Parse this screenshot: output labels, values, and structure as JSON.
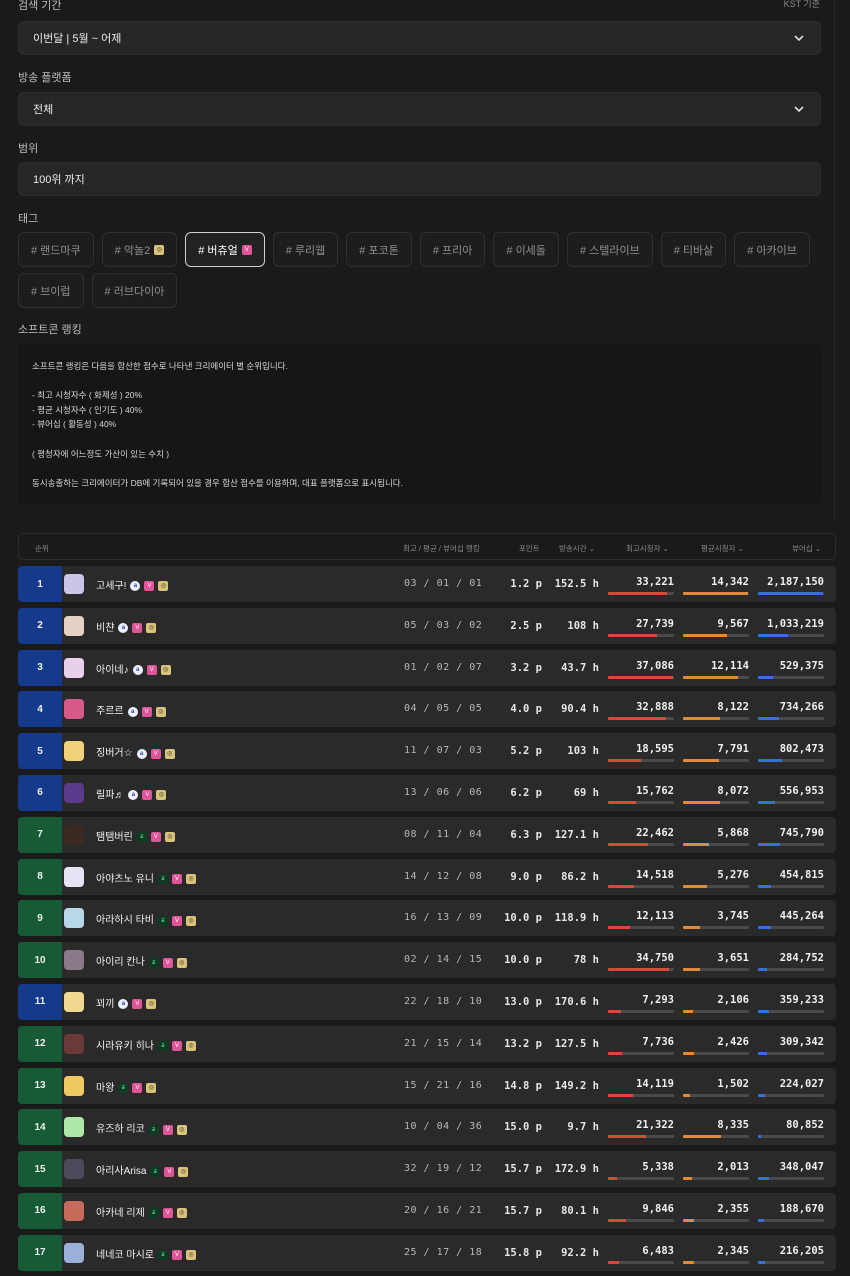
{
  "filters": {
    "period_label": "검색 기간",
    "kst_note": "KST 기준",
    "period_value": "이번달 | 5월 ~ 어제",
    "platform_label": "방송 플랫폼",
    "platform_value": "전체",
    "range_label": "범위",
    "range_value": "100위 까지",
    "tags_label": "태그",
    "tags": [
      "# 랜드마쿠",
      "# 악놀2",
      "# 버츄얼",
      "# 루리웹",
      "# 포코톤",
      "# 프리아",
      "# 이세돌",
      "# 스텔라이브",
      "# 티바살",
      "# 아카이브",
      "# 브이럽",
      "# 러브다이아"
    ]
  },
  "ranking_info": {
    "title": "소프트콘 랭킹",
    "lines": [
      "소프트콘 랭킹은 다음을 합산한 점수로 나타낸 크리에이터 별 순위입니다.",
      "",
      "- 최고 시청자수 ( 화제성 ) 20%",
      "- 평균 시청자수 ( 인기도 ) 40%",
      "- 뷰어십 ( 활동성 ) 40%",
      "",
      "( 평청자에 어느정도 가산이 있는 수치 )",
      "",
      "동시송출하는 크리에이터가 DB에 기록되어 있을 경우 합산 점수를 이용하며, 대표 플랫폼으로 표시됩니다."
    ]
  },
  "table": {
    "headers": {
      "rank": "순위",
      "sub_ranks": "최고 / 평균 / 뷰어십 랭킹",
      "points": "포인트",
      "hours": "방송시간 ⌄",
      "peak": "최고시청자 ⌄",
      "avg": "평균시청자 ⌄",
      "viewership": "뷰어십 ⌄"
    },
    "colors": {
      "blue_rank": "#153a8c",
      "green_rank": "#165a36",
      "peak_bar": "#d94a3a",
      "avg_bar": "#e08a3c",
      "viewership_bar": "#3a6fd9"
    },
    "rows": [
      {
        "rank": "1",
        "name": "고세구!",
        "platform": "blue",
        "ranks": "03 / 01 / 01",
        "points": "1.2 p",
        "hours": "152.5 h",
        "peak": "33,221",
        "avg": "14,342",
        "viewership": "2,187,150",
        "pf": 0.89,
        "af": 0.98,
        "vf": 0.98,
        "avatar": "#c9c6e8"
      },
      {
        "rank": "2",
        "name": "비챤",
        "platform": "blue",
        "ranks": "05 / 03 / 02",
        "points": "2.5 p",
        "hours": "108 h",
        "peak": "27,739",
        "avg": "9,567",
        "viewership": "1,033,219",
        "pf": 0.74,
        "af": 0.66,
        "vf": 0.46,
        "avatar": "#e6d2c4"
      },
      {
        "rank": "3",
        "name": "아이네♪",
        "platform": "blue",
        "ranks": "01 / 02 / 07",
        "points": "3.2 p",
        "hours": "43.7 h",
        "peak": "37,086",
        "avg": "12,114",
        "viewership": "529,375",
        "pf": 0.99,
        "af": 0.84,
        "vf": 0.23,
        "avatar": "#e8d0ea"
      },
      {
        "rank": "4",
        "name": "주르르",
        "platform": "blue",
        "ranks": "04 / 05 / 05",
        "points": "4.0 p",
        "hours": "90.4 h",
        "peak": "32,888",
        "avg": "8,122",
        "viewership": "734,266",
        "pf": 0.88,
        "af": 0.56,
        "vf": 0.32,
        "avatar": "#d65a8a"
      },
      {
        "rank": "5",
        "name": "징버거☆",
        "platform": "blue",
        "ranks": "11 / 07 / 03",
        "points": "5.2 p",
        "hours": "103 h",
        "peak": "18,595",
        "avg": "7,791",
        "viewership": "802,473",
        "pf": 0.5,
        "af": 0.54,
        "vf": 0.36,
        "avatar": "#f0d27a"
      },
      {
        "rank": "6",
        "name": "릴파♬",
        "platform": "blue",
        "ranks": "13 / 06 / 06",
        "points": "6.2 p",
        "hours": "69 h",
        "peak": "15,762",
        "avg": "8,072",
        "viewership": "556,953",
        "pf": 0.42,
        "af": 0.56,
        "vf": 0.25,
        "avatar": "#5a3a8a"
      },
      {
        "rank": "7",
        "name": "탬탬버린",
        "platform": "green",
        "ranks": "08 / 11 / 04",
        "points": "6.3 p",
        "hours": "127.1 h",
        "peak": "22,462",
        "avg": "5,868",
        "viewership": "745,790",
        "pf": 0.6,
        "af": 0.4,
        "vf": 0.33,
        "avatar": "#3a2a22"
      },
      {
        "rank": "8",
        "name": "아야츠노 유니",
        "platform": "green",
        "ranks": "14 / 12 / 08",
        "points": "9.0 p",
        "hours": "86.2 h",
        "peak": "14,518",
        "avg": "5,276",
        "viewership": "454,815",
        "pf": 0.39,
        "af": 0.36,
        "vf": 0.2,
        "avatar": "#e4e4f4"
      },
      {
        "rank": "9",
        "name": "아라하시 타비",
        "platform": "green",
        "ranks": "16 / 13 / 09",
        "points": "10.0 p",
        "hours": "118.9 h",
        "peak": "12,113",
        "avg": "3,745",
        "viewership": "445,264",
        "pf": 0.33,
        "af": 0.26,
        "vf": 0.2,
        "avatar": "#b8d8ea"
      },
      {
        "rank": "10",
        "name": "아이리 칸나",
        "platform": "green",
        "ranks": "02 / 14 / 15",
        "points": "10.0 p",
        "hours": "78 h",
        "peak": "34,750",
        "avg": "3,651",
        "viewership": "284,752",
        "pf": 0.93,
        "af": 0.25,
        "vf": 0.13,
        "avatar": "#8a7a88"
      },
      {
        "rank": "11",
        "name": "꾀끼",
        "platform": "blue",
        "ranks": "22 / 18 / 10",
        "points": "13.0 p",
        "hours": "170.6 h",
        "peak": "7,293",
        "avg": "2,106",
        "viewership": "359,233",
        "pf": 0.2,
        "af": 0.15,
        "vf": 0.16,
        "avatar": "#f0d890"
      },
      {
        "rank": "12",
        "name": "시라유키 히나",
        "platform": "green",
        "ranks": "21 / 15 / 14",
        "points": "13.2 p",
        "hours": "127.5 h",
        "peak": "7,736",
        "avg": "2,426",
        "viewership": "309,342",
        "pf": 0.21,
        "af": 0.17,
        "vf": 0.14,
        "avatar": "#6a3a3a"
      },
      {
        "rank": "13",
        "name": "마왕",
        "platform": "green",
        "ranks": "15 / 21 / 16",
        "points": "14.8 p",
        "hours": "149.2 h",
        "peak": "14,119",
        "avg": "1,502",
        "viewership": "224,027",
        "pf": 0.38,
        "af": 0.11,
        "vf": 0.1,
        "avatar": "#f0c860"
      },
      {
        "rank": "14",
        "name": "유즈하 리코",
        "platform": "green",
        "ranks": "10 / 04 / 36",
        "points": "15.0 p",
        "hours": "9.7 h",
        "peak": "21,322",
        "avg": "8,335",
        "viewership": "80,852",
        "pf": 0.57,
        "af": 0.58,
        "vf": 0.04,
        "avatar": "#aee8a8"
      },
      {
        "rank": "15",
        "name": "아리사Arisa",
        "platform": "green",
        "ranks": "32 / 19 / 12",
        "points": "15.7 p",
        "hours": "172.9 h",
        "peak": "5,338",
        "avg": "2,013",
        "viewership": "348,047",
        "pf": 0.14,
        "af": 0.14,
        "vf": 0.16,
        "avatar": "#4a4a5a"
      },
      {
        "rank": "16",
        "name": "아카네 리제",
        "platform": "green",
        "ranks": "20 / 16 / 21",
        "points": "15.7 p",
        "hours": "80.1 h",
        "peak": "9,846",
        "avg": "2,355",
        "viewership": "188,670",
        "pf": 0.27,
        "af": 0.16,
        "vf": 0.09,
        "avatar": "#c86a5a"
      },
      {
        "rank": "17",
        "name": "네네코 마시로",
        "platform": "green",
        "ranks": "25 / 17 / 18",
        "points": "15.8 p",
        "hours": "92.2 h",
        "peak": "6,483",
        "avg": "2,345",
        "viewership": "216,205",
        "pf": 0.17,
        "af": 0.16,
        "vf": 0.1,
        "avatar": "#9ab0d8"
      }
    ]
  }
}
